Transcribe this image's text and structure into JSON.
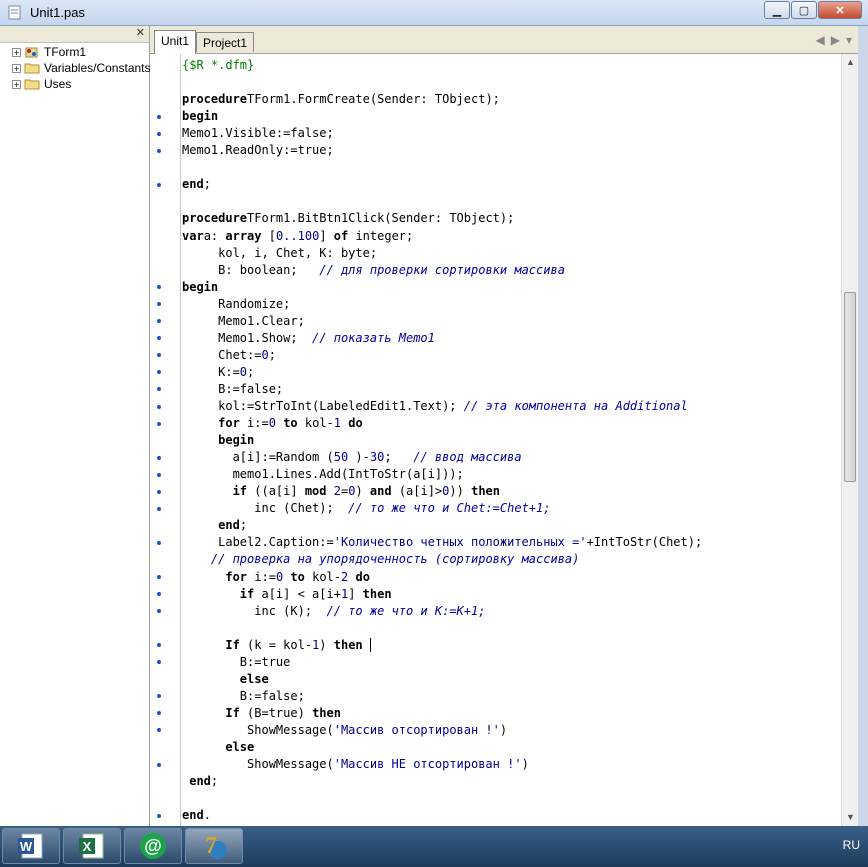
{
  "window": {
    "title": "Unit1.pas"
  },
  "tree": {
    "items": [
      {
        "label": "TForm1",
        "icon": "form-icon"
      },
      {
        "label": "Variables/Constants",
        "icon": "folder-icon"
      },
      {
        "label": "Uses",
        "icon": "folder-icon"
      }
    ]
  },
  "tabs": [
    {
      "label": "Unit1"
    },
    {
      "label": "Project1"
    }
  ],
  "code_lines": [
    {
      "text": "{$R *.dfm}",
      "dot": false,
      "segs": [
        [
          "dir",
          "{$R *.dfm}"
        ]
      ]
    },
    {
      "text": "",
      "dot": false,
      "segs": []
    },
    {
      "text": "procedure TForm1.FormCreate(Sender: TObject);",
      "dot": false,
      "segs": [
        [
          "kw",
          "procedure"
        ],
        [
          "",
          "TForm1.FormCreate(Sender: TObject);"
        ]
      ]
    },
    {
      "text": "begin",
      "dot": true,
      "segs": [
        [
          "kw",
          "begin"
        ]
      ]
    },
    {
      "text": "Memo1.Visible:=false;",
      "dot": true,
      "segs": [
        [
          "",
          "Memo1.Visible:=false;"
        ]
      ]
    },
    {
      "text": "Memo1.ReadOnly:=true;",
      "dot": true,
      "segs": [
        [
          "",
          "Memo1.ReadOnly:=true;"
        ]
      ]
    },
    {
      "text": "",
      "dot": false,
      "segs": []
    },
    {
      "text": "end;",
      "dot": true,
      "segs": [
        [
          "kw",
          "end"
        ],
        [
          "",
          ";"
        ]
      ]
    },
    {
      "text": "",
      "dot": false,
      "segs": []
    },
    {
      "text": "procedure TForm1.BitBtn1Click(Sender: TObject);",
      "dot": false,
      "segs": [
        [
          "kw",
          "procedure"
        ],
        [
          "",
          "TForm1.BitBtn1Click(Sender: TObject);"
        ]
      ]
    },
    {
      "text": "var a: array [0..100] of integer;",
      "dot": false,
      "segs": [
        [
          "kw",
          "var"
        ],
        [
          "",
          "a: "
        ],
        [
          "kw",
          "array"
        ],
        [
          "",
          " ["
        ],
        [
          "num",
          "0..100"
        ],
        [
          "",
          "] "
        ],
        [
          "kw",
          "of"
        ],
        [
          "",
          " integer;"
        ]
      ]
    },
    {
      "text": "     kol, i, Chet, K: byte;",
      "dot": false,
      "segs": [
        [
          "",
          "     kol, i, Chet, K: byte;"
        ]
      ]
    },
    {
      "text": "     B: boolean;   // для проверки сортировки массива",
      "dot": false,
      "segs": [
        [
          "",
          "     B: boolean;   "
        ],
        [
          "com",
          "// для проверки сортировки массива"
        ]
      ]
    },
    {
      "text": "begin",
      "dot": true,
      "segs": [
        [
          "kw",
          "begin"
        ]
      ]
    },
    {
      "text": "     Randomize;",
      "dot": true,
      "segs": [
        [
          "",
          "     Randomize;"
        ]
      ]
    },
    {
      "text": "     Memo1.Clear;",
      "dot": true,
      "segs": [
        [
          "",
          "     Memo1.Clear;"
        ]
      ]
    },
    {
      "text": "     Memo1.Show;  // показать Memo1",
      "dot": true,
      "segs": [
        [
          "",
          "     Memo1.Show;  "
        ],
        [
          "com",
          "// показать Memo1"
        ]
      ]
    },
    {
      "text": "     Chet:=0;",
      "dot": true,
      "segs": [
        [
          "",
          "     Chet:="
        ],
        [
          "num",
          "0"
        ],
        [
          "",
          ";"
        ]
      ]
    },
    {
      "text": "     K:=0;",
      "dot": true,
      "segs": [
        [
          "",
          "     K:="
        ],
        [
          "num",
          "0"
        ],
        [
          "",
          ";"
        ]
      ]
    },
    {
      "text": "     B:=false;",
      "dot": true,
      "segs": [
        [
          "",
          "     B:=false;"
        ]
      ]
    },
    {
      "text": "     kol:=StrToInt(LabeledEdit1.Text); // эта компонента на Additional",
      "dot": true,
      "segs": [
        [
          "",
          "     kol:=StrToInt(LabeledEdit1.Text); "
        ],
        [
          "com",
          "// эта компонента на Additional"
        ]
      ]
    },
    {
      "text": "     for i:=0 to kol-1 do",
      "dot": true,
      "segs": [
        [
          "",
          "     "
        ],
        [
          "kw",
          "for"
        ],
        [
          "",
          " i:="
        ],
        [
          "num",
          "0"
        ],
        [
          "",
          " "
        ],
        [
          "kw",
          "to"
        ],
        [
          "",
          " kol-"
        ],
        [
          "num",
          "1"
        ],
        [
          "",
          " "
        ],
        [
          "kw",
          "do"
        ]
      ]
    },
    {
      "text": "     begin",
      "dot": false,
      "segs": [
        [
          "",
          "     "
        ],
        [
          "kw",
          "begin"
        ]
      ]
    },
    {
      "text": "       a[i]:=Random (50)-30;   // ввод массива",
      "dot": true,
      "segs": [
        [
          "",
          "       a[i]:=Random ("
        ],
        [
          "num",
          "50"
        ],
        [
          "",
          " )-"
        ],
        [
          "num",
          "30"
        ],
        [
          "",
          ";   "
        ],
        [
          "com",
          "// ввод массива"
        ]
      ]
    },
    {
      "text": "       memo1.Lines.Add(IntToStr(a[i]));",
      "dot": true,
      "segs": [
        [
          "",
          "       memo1.Lines.Add(IntToStr(a[i]));"
        ]
      ]
    },
    {
      "text": "       if ((a[i] mod 2=0) and (a[i]>0)) then",
      "dot": true,
      "segs": [
        [
          "",
          "       "
        ],
        [
          "kw",
          "if"
        ],
        [
          "",
          " ((a[i] "
        ],
        [
          "kw",
          "mod"
        ],
        [
          "",
          " "
        ],
        [
          "num",
          "2"
        ],
        [
          "",
          "="
        ],
        [
          "num",
          "0"
        ],
        [
          "",
          ") "
        ],
        [
          "kw",
          "and"
        ],
        [
          "",
          " (a[i]>"
        ],
        [
          "num",
          "0"
        ],
        [
          "",
          "))"
        ],
        [
          "",
          " "
        ],
        [
          "kw",
          "then"
        ]
      ]
    },
    {
      "text": "          inc (Chet);  // то же что и Chet:=Chet+1;",
      "dot": true,
      "segs": [
        [
          "",
          "          inc (Chet);  "
        ],
        [
          "com",
          "// то же что и Chet:=Chet+1;"
        ]
      ]
    },
    {
      "text": "     end;",
      "dot": false,
      "segs": [
        [
          "",
          "     "
        ],
        [
          "kw",
          "end"
        ],
        [
          "",
          ";"
        ]
      ]
    },
    {
      "text": "     Label2.Caption:='Количество четных положительных ='+IntToStr(Chet);",
      "dot": true,
      "segs": [
        [
          "",
          "     Label2.Caption:="
        ],
        [
          "str",
          "'Количество четных положительных ='"
        ],
        [
          "",
          "+IntToStr(Chet);"
        ]
      ]
    },
    {
      "text": "    // проверка на упорядоченность (сортировку массива)",
      "dot": false,
      "segs": [
        [
          "",
          "    "
        ],
        [
          "com",
          "// проверка на упорядоченность (сортировку массива)"
        ]
      ]
    },
    {
      "text": "      for i:=0 to kol-2 do",
      "dot": true,
      "segs": [
        [
          "",
          "      "
        ],
        [
          "kw",
          "for"
        ],
        [
          "",
          " i:="
        ],
        [
          "num",
          "0"
        ],
        [
          "",
          " "
        ],
        [
          "kw",
          "to"
        ],
        [
          "",
          " kol-"
        ],
        [
          "num",
          "2"
        ],
        [
          "",
          " "
        ],
        [
          "kw",
          "do"
        ]
      ]
    },
    {
      "text": "        if a[i] < a[i+1] then",
      "dot": true,
      "segs": [
        [
          "",
          "        "
        ],
        [
          "kw",
          "if"
        ],
        [
          "",
          " a[i] < a[i+"
        ],
        [
          "num",
          "1"
        ],
        [
          "",
          "] "
        ],
        [
          "kw",
          "then"
        ]
      ]
    },
    {
      "text": "          inc (K);  // то же что и K:=K+1;",
      "dot": true,
      "segs": [
        [
          "",
          "          inc (K);  "
        ],
        [
          "com",
          "// то же что и K:=K+1;"
        ]
      ]
    },
    {
      "text": "",
      "dot": false,
      "segs": []
    },
    {
      "text": "      If (k = kol-1) then ",
      "dot": true,
      "caret": true,
      "segs": [
        [
          "",
          "      "
        ],
        [
          "kw",
          "If"
        ],
        [
          "",
          " (k = kol-"
        ],
        [
          "num",
          "1"
        ],
        [
          "",
          ") "
        ],
        [
          "kw",
          "then"
        ],
        [
          "",
          " "
        ]
      ]
    },
    {
      "text": "        B:=true",
      "dot": true,
      "segs": [
        [
          "",
          "        B:=true"
        ]
      ]
    },
    {
      "text": "        else",
      "dot": false,
      "segs": [
        [
          "",
          "        "
        ],
        [
          "kw",
          "else"
        ]
      ]
    },
    {
      "text": "        B:=false;",
      "dot": true,
      "segs": [
        [
          "",
          "        B:=false;"
        ]
      ]
    },
    {
      "text": "      If (B=true) then",
      "dot": true,
      "segs": [
        [
          "",
          "      "
        ],
        [
          "kw",
          "If"
        ],
        [
          "",
          " (B=true) "
        ],
        [
          "kw",
          "then"
        ]
      ]
    },
    {
      "text": "         ShowMessage('Массив отсортирован !')",
      "dot": true,
      "segs": [
        [
          "",
          "         ShowMessage("
        ],
        [
          "str",
          "'Массив отсортирован !'"
        ],
        [
          "",
          ")"
        ]
      ]
    },
    {
      "text": "      else",
      "dot": false,
      "segs": [
        [
          "",
          "      "
        ],
        [
          "kw",
          "else"
        ]
      ]
    },
    {
      "text": "         ShowMessage('Массив НЕ отсортирован !')",
      "dot": true,
      "segs": [
        [
          "",
          "         ShowMessage("
        ],
        [
          "str",
          "'Массив НЕ отсортирован !'"
        ],
        [
          "",
          ")"
        ]
      ]
    },
    {
      "text": " end;",
      "dot": false,
      "segs": [
        [
          "",
          " "
        ],
        [
          "kw",
          "end"
        ],
        [
          "",
          ";"
        ]
      ]
    },
    {
      "text": "",
      "dot": false,
      "segs": []
    },
    {
      "text": "end.",
      "dot": true,
      "segs": [
        [
          "kw",
          "end"
        ],
        [
          "",
          "."
        ]
      ]
    }
  ],
  "taskbar": {
    "apps": [
      {
        "name": "word-icon",
        "label": "W"
      },
      {
        "name": "excel-icon",
        "label": "X"
      },
      {
        "name": "mail-agent-icon",
        "label": "@"
      },
      {
        "name": "delphi-icon",
        "label": "7"
      }
    ],
    "language": "RU"
  },
  "colors": {
    "gutter_dot": "#2050c8",
    "string": "#00008b",
    "comment": "#0000a0",
    "directive": "#008000"
  }
}
